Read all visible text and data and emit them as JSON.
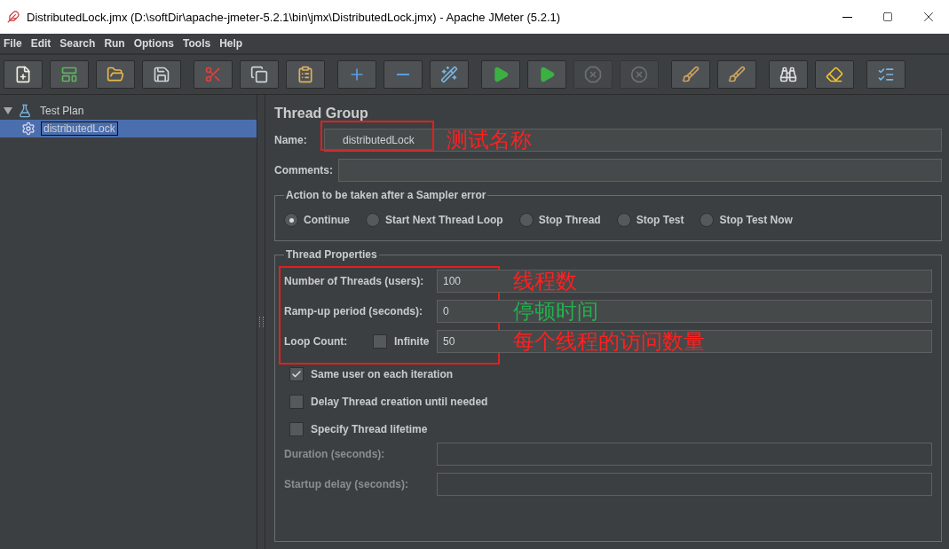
{
  "window": {
    "title": "DistributedLock.jmx (D:\\softDir\\apache-jmeter-5.2.1\\bin\\jmx\\DistributedLock.jmx) - Apache JMeter (5.2.1)"
  },
  "menu": [
    {
      "label": "File"
    },
    {
      "label": "Edit"
    },
    {
      "label": "Search"
    },
    {
      "label": "Run"
    },
    {
      "label": "Options"
    },
    {
      "label": "Tools"
    },
    {
      "label": "Help"
    }
  ],
  "toolbar": [
    [
      {
        "kind": "new",
        "disabled": false
      },
      {
        "kind": "templates",
        "disabled": false
      },
      {
        "kind": "open",
        "disabled": false
      },
      {
        "kind": "save",
        "disabled": false
      }
    ],
    [
      {
        "kind": "cut",
        "disabled": false
      },
      {
        "kind": "copy",
        "disabled": false
      },
      {
        "kind": "paste",
        "disabled": false
      }
    ],
    [
      {
        "kind": "expand",
        "disabled": false
      },
      {
        "kind": "collapse",
        "disabled": false
      },
      {
        "kind": "toggle",
        "disabled": false
      }
    ],
    [
      {
        "kind": "start",
        "disabled": false
      },
      {
        "kind": "start-no-pause",
        "disabled": false
      },
      {
        "kind": "stop",
        "disabled": true
      },
      {
        "kind": "shutdown",
        "disabled": true
      }
    ],
    [
      {
        "kind": "clear",
        "disabled": false
      },
      {
        "kind": "clear-all",
        "disabled": false
      }
    ],
    [
      {
        "kind": "search",
        "disabled": false
      },
      {
        "kind": "reset-search",
        "disabled": false
      }
    ],
    [
      {
        "kind": "function-helper",
        "disabled": false
      }
    ]
  ],
  "tree": [
    {
      "label": "Test Plan",
      "kind": "plan",
      "expanded": true,
      "selected": false,
      "children": [
        {
          "label": "distributedLock",
          "kind": "thread-group",
          "selected": true
        }
      ]
    }
  ],
  "editor": {
    "title": "Thread Group",
    "name": {
      "label": "Name:",
      "value": "distributedLock",
      "highlighted": true,
      "note": {
        "text": "测试名称",
        "color": "#ff2020"
      }
    },
    "comments": {
      "label": "Comments:"
    },
    "error_action": {
      "legend": "Action to be taken after a Sampler error",
      "options": [
        {
          "label": "Continue",
          "selected": true
        },
        {
          "label": "Start Next Thread Loop",
          "selected": false
        },
        {
          "label": "Stop Thread",
          "selected": false
        },
        {
          "label": "Stop Test",
          "selected": false
        },
        {
          "label": "Stop Test Now",
          "selected": false
        }
      ]
    },
    "thread_properties": {
      "legend": "Thread Properties",
      "highlighted": true,
      "threads": {
        "label": "Number of Threads (users):",
        "value": "100",
        "note": {
          "text": "线程数",
          "color": "#ff2020"
        }
      },
      "ramp_up": {
        "label": "Ramp-up period (seconds):",
        "value": "0",
        "note": {
          "text": "停顿时间",
          "color": "#22b14c"
        }
      },
      "loop_count": {
        "label": "Loop Count:",
        "infinite": {
          "label": "Infinite",
          "checked": false
        },
        "value": "50",
        "note": {
          "text": "每个线程的访问数量",
          "color": "#ff2020"
        }
      },
      "options": [
        {
          "label": "Same user on each iteration",
          "checked": true
        },
        {
          "label": "Delay Thread creation until needed",
          "checked": false
        },
        {
          "label": "Specify Thread lifetime",
          "checked": false
        }
      ],
      "duration": {
        "label": "Duration (seconds):",
        "disabled": true
      },
      "startup_delay": {
        "label": "Startup delay (seconds):",
        "disabled": true
      }
    }
  }
}
